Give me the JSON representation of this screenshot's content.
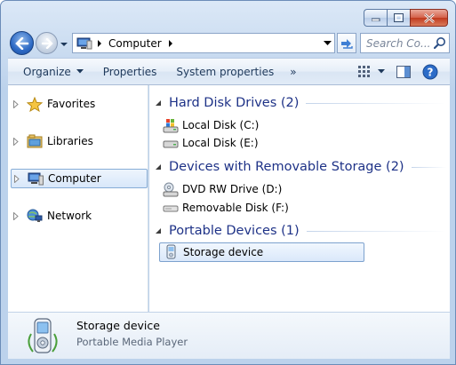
{
  "window": {
    "caption": {
      "minimize": "minimize",
      "maximize": "maximize",
      "close": "close"
    }
  },
  "nav": {
    "address": {
      "location": "Computer"
    },
    "search": {
      "placeholder": "Search Co..."
    }
  },
  "toolbar": {
    "organize": "Organize",
    "properties": "Properties",
    "system_properties": "System properties",
    "more": "»"
  },
  "sidebar": {
    "items": [
      {
        "label": "Favorites",
        "icon": "star-icon"
      },
      {
        "label": "Libraries",
        "icon": "libraries-icon"
      },
      {
        "label": "Computer",
        "icon": "computer-icon",
        "selected": true
      },
      {
        "label": "Network",
        "icon": "network-icon"
      }
    ]
  },
  "content": {
    "groups": [
      {
        "title": "Hard Disk Drives (2)",
        "items": [
          {
            "label": "Local Disk (C:)",
            "icon": "system-drive-icon"
          },
          {
            "label": "Local Disk (E:)",
            "icon": "hard-drive-icon"
          }
        ]
      },
      {
        "title": "Devices with Removable Storage (2)",
        "items": [
          {
            "label": "DVD RW Drive (D:)",
            "icon": "dvd-drive-icon"
          },
          {
            "label": "Removable Disk (F:)",
            "icon": "removable-disk-icon"
          }
        ]
      },
      {
        "title": "Portable Devices (1)",
        "items": [
          {
            "label": "Storage device",
            "icon": "portable-device-icon",
            "selected": true
          }
        ]
      }
    ]
  },
  "details": {
    "name": "Storage device",
    "type": "Portable Media Player"
  },
  "colors": {
    "accent": "#1e3287",
    "selection_border": "#7da2ce"
  }
}
